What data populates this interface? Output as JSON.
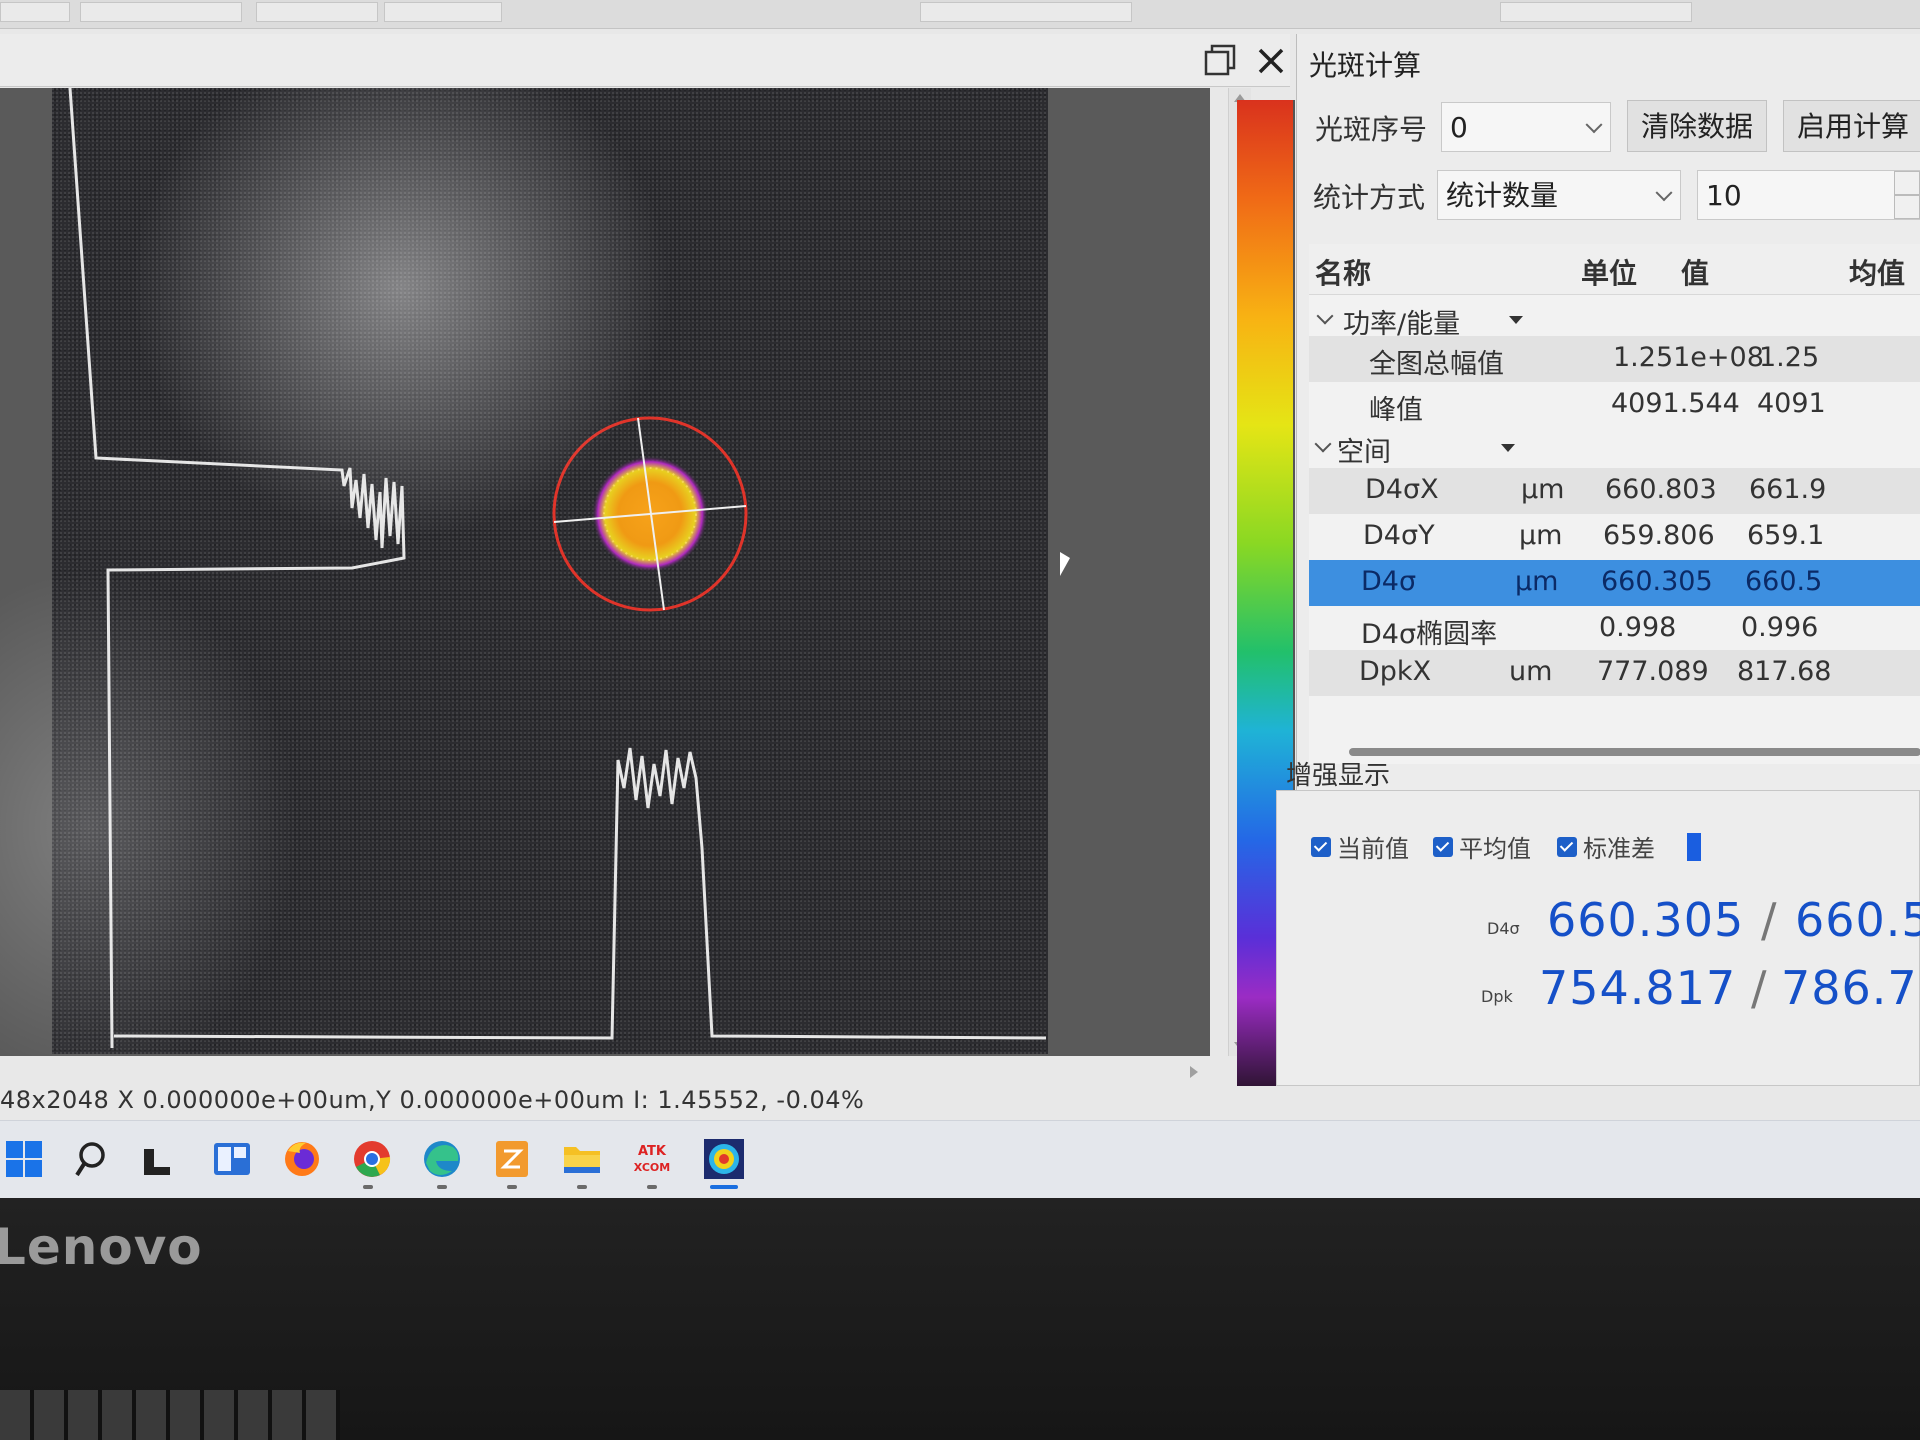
{
  "app": {
    "panel_title": "光斑计算",
    "status_bar": "48x2048   X 0.000000e+00um,Y 0.000000e+00um I: 1.45552, -0.04%"
  },
  "controls": {
    "spot_index_label": "光斑序号",
    "spot_index_value": "0",
    "clear_button": "清除数据",
    "enable_button": "启用计算",
    "stat_method_label": "统计方式",
    "stat_method_value": "统计数量",
    "stat_count_value": "10"
  },
  "table": {
    "headers": [
      "名称",
      "单位",
      "值",
      "均值"
    ],
    "groups": [
      {
        "name": "功率/能量"
      },
      {
        "name": "空间"
      }
    ],
    "rows": [
      {
        "name": "全图总幅值",
        "unit": "",
        "value": "1.251e+08",
        "mean": "1.25"
      },
      {
        "name": "峰值",
        "unit": "",
        "value": "4091.544",
        "mean": "4091"
      },
      {
        "name": "D4σX",
        "unit": "μm",
        "value": "660.803",
        "mean": "661.9"
      },
      {
        "name": "D4σY",
        "unit": "μm",
        "value": "659.806",
        "mean": "659.1"
      },
      {
        "name": "D4σ",
        "unit": "μm",
        "value": "660.305",
        "mean": "660.5"
      },
      {
        "name": "D4σ椭圆率",
        "unit": "",
        "value": "0.998",
        "mean": "0.996"
      },
      {
        "name": "DpkX",
        "unit": "um",
        "value": "777.089",
        "mean": "817.68"
      }
    ]
  },
  "enhanced": {
    "title": "增强显示",
    "checkboxes": [
      "当前值",
      "平均值",
      "标准差"
    ],
    "rows": [
      {
        "label": "D4σ",
        "current": "660.305",
        "mean": "660.5"
      },
      {
        "label": "Dpk",
        "current": "754.817",
        "mean": "786.7"
      }
    ]
  },
  "device": {
    "brand": "Lenovo"
  },
  "colors": {
    "selected_row": "#3d8fe0",
    "big_value": "#1550c8",
    "beam_ring": "#e0342a"
  },
  "taskbar_icons": [
    "windows-start",
    "search",
    "task-view",
    "widgets",
    "firefox",
    "chrome",
    "edge",
    "office-app",
    "file-explorer",
    "atk-xcom",
    "beam-profiler"
  ]
}
